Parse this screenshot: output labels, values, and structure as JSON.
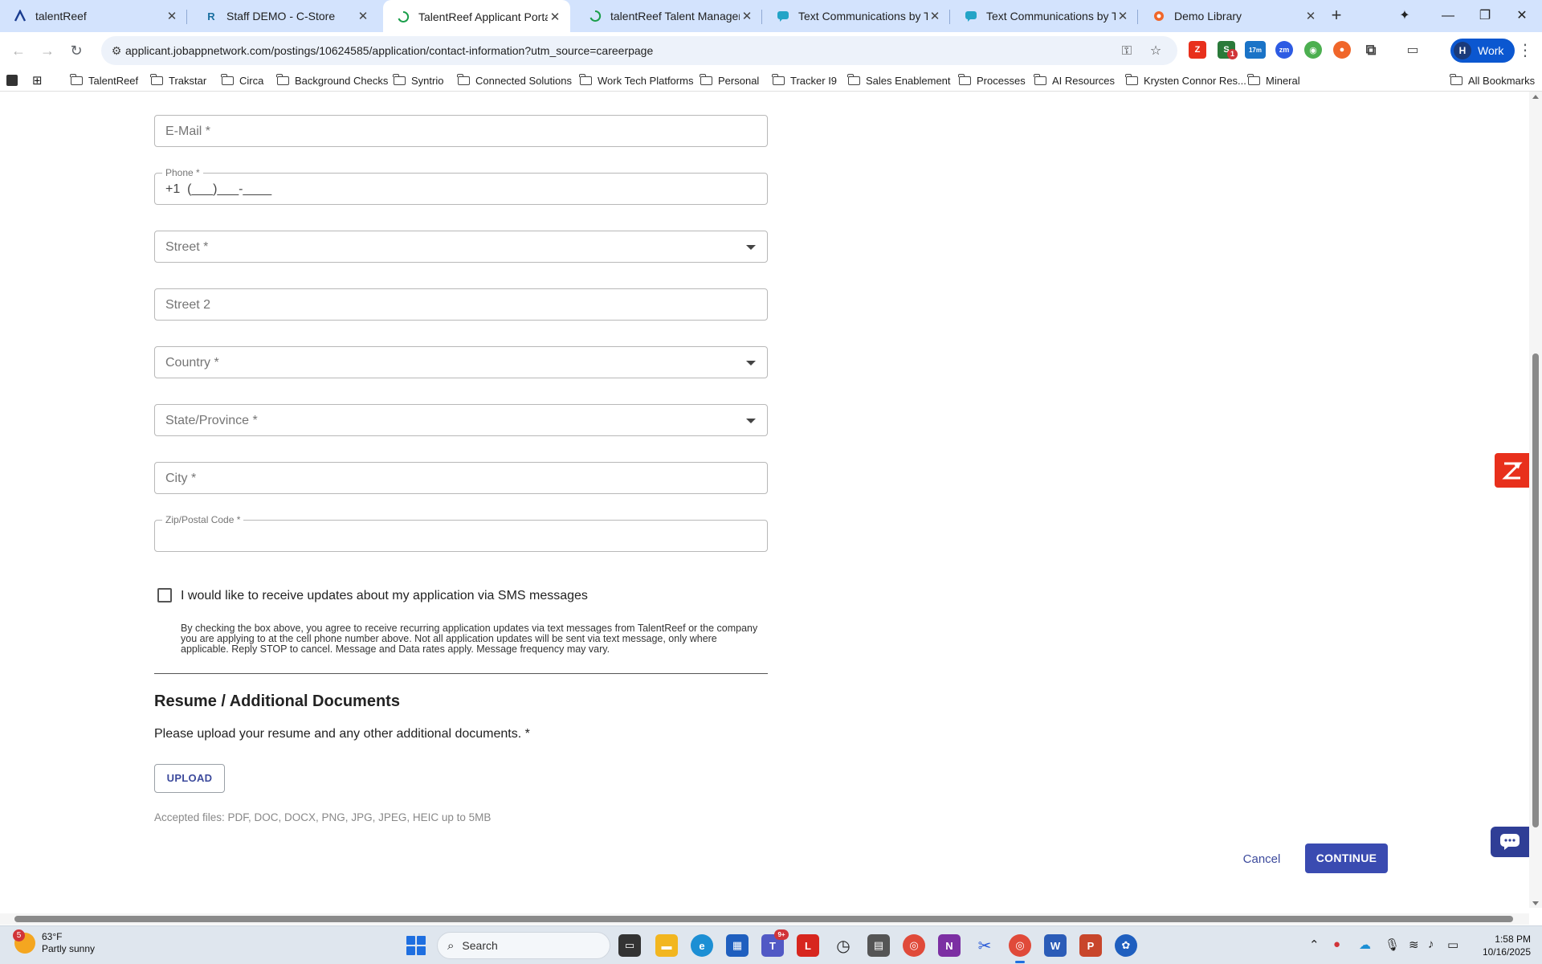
{
  "tabs": [
    {
      "title": "talentReef",
      "icon": "talentreef-icon",
      "active": false
    },
    {
      "title": "Staff DEMO - C-Store",
      "icon": "r-logo-icon",
      "active": false
    },
    {
      "title": "TalentReef Applicant Portal",
      "icon": "loading-spinner-icon",
      "active": true
    },
    {
      "title": "talentReef Talent Management",
      "icon": "loading-spinner-icon",
      "active": false
    },
    {
      "title": "Text Communications by Talent",
      "icon": "chat-bubble-icon",
      "active": false
    },
    {
      "title": "Text Communications by Talent",
      "icon": "chat-bubble-icon",
      "active": false
    },
    {
      "title": "Demo Library",
      "icon": "orange-logo-icon",
      "active": false
    }
  ],
  "toolbar": {
    "url": "applicant.jobappnetwork.com/postings/10624585/application/contact-information?utm_source=careerpage",
    "profile_initial": "H",
    "profile_label": "Work",
    "ext_badge_count": "1",
    "ext_timer_label": "17m"
  },
  "bookmarks": [
    {
      "label": "TalentReef",
      "type": "app"
    },
    {
      "label": "Trakstar",
      "type": "folder"
    },
    {
      "label": "Circa",
      "type": "folder"
    },
    {
      "label": "Background Checks",
      "type": "folder"
    },
    {
      "label": "Syntrio",
      "type": "folder"
    },
    {
      "label": "Connected Solutions",
      "type": "folder"
    },
    {
      "label": "Work Tech Platforms",
      "type": "folder"
    },
    {
      "label": "Personal",
      "type": "folder"
    },
    {
      "label": "Tracker I9",
      "type": "folder"
    },
    {
      "label": "Sales Enablement",
      "type": "folder"
    },
    {
      "label": "Processes",
      "type": "folder"
    },
    {
      "label": "AI Resources",
      "type": "folder"
    },
    {
      "label": "Krysten Connor Res...",
      "type": "folder"
    },
    {
      "label": "Mineral",
      "type": "folder"
    }
  ],
  "all_bookmarks_label": "All Bookmarks",
  "form": {
    "email_placeholder": "E-Mail *",
    "phone_label": "Phone *",
    "phone_value": "+1  (___)___-____",
    "street_placeholder": "Street *",
    "street2_placeholder": "Street 2",
    "country_placeholder": "Country *",
    "state_placeholder": "State/Province *",
    "city_placeholder": "City *",
    "zip_label": "Zip/Postal Code *",
    "sms_label": "I would like to receive updates about my application via SMS messages",
    "sms_disclaimer": "By checking the box above, you agree to receive recurring application updates via text messages from TalentReef or the company you are applying to at the cell phone number above. Not all application updates will be sent via text message, only where applicable. Reply STOP to cancel. Message and Data rates apply. Message frequency may vary.",
    "sms_checked": false
  },
  "documents": {
    "section_title": "Resume / Additional Documents",
    "prompt": "Please upload your resume and any other additional documents. *",
    "upload_label": "UPLOAD",
    "accepted": "Accepted files: PDF, DOC, DOCX, PNG, JPG, JPEG, HEIC up to 5MB"
  },
  "actions": {
    "cancel_label": "Cancel",
    "continue_label": "CONTINUE"
  },
  "taskbar": {
    "weather_temp": "63°F",
    "weather_desc": "Partly sunny",
    "weather_badge": "5",
    "search_label": "Search",
    "teams_badge": "9+",
    "time": "1:58 PM",
    "date": "10/16/2025"
  },
  "colors": {
    "primary": "#3a4bb1",
    "tabstrip": "#d3e3fd",
    "widget_red": "#e8301c"
  }
}
